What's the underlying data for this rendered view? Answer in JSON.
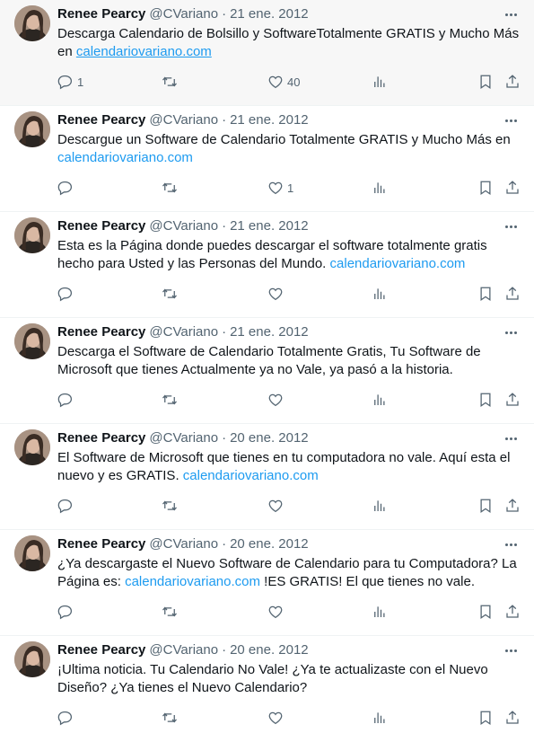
{
  "tweets": [
    {
      "name": "Renee Pearcy",
      "handle": "@CVariano",
      "dot": "·",
      "date": "21 ene. 2012",
      "text_before": "Descarga Calendario de Bolsillo y SoftwareTotalmente GRATIS y Mucho Más en ",
      "link": "calendariovariano.com",
      "text_after": "",
      "replies": "1",
      "retweets": "",
      "likes": "40",
      "highlighted": true
    },
    {
      "name": "Renee Pearcy",
      "handle": "@CVariano",
      "dot": "·",
      "date": "21 ene. 2012",
      "text_before": "Descargue un Software de Calendario Totalmente GRATIS y Mucho Más en ",
      "link": "calendariovariano.com",
      "text_after": "",
      "replies": "",
      "retweets": "",
      "likes": "1"
    },
    {
      "name": "Renee Pearcy",
      "handle": "@CVariano",
      "dot": "·",
      "date": "21 ene. 2012",
      "text_before": "Esta es la Página donde puedes descargar el software totalmente gratis hecho para Usted y las Personas del Mundo. ",
      "link": "calendariovariano.com",
      "text_after": "",
      "replies": "",
      "retweets": "",
      "likes": ""
    },
    {
      "name": "Renee Pearcy",
      "handle": "@CVariano",
      "dot": "·",
      "date": "21 ene. 2012",
      "text_before": "Descarga el Software de Calendario Totalmente Gratis, Tu Software de Microsoft que tienes Actualmente ya no Vale, ya pasó a la historia.",
      "link": "",
      "text_after": "",
      "replies": "",
      "retweets": "",
      "likes": ""
    },
    {
      "name": "Renee Pearcy",
      "handle": "@CVariano",
      "dot": "·",
      "date": "20 ene. 2012",
      "text_before": "El Software de Microsoft que tienes en tu computadora no vale. Aquí esta el nuevo y es GRATIS. ",
      "link": "calendariovariano.com",
      "text_after": "",
      "replies": "",
      "retweets": "",
      "likes": ""
    },
    {
      "name": "Renee Pearcy",
      "handle": "@CVariano",
      "dot": "·",
      "date": "20 ene. 2012",
      "text_before": "¿Ya descargaste el Nuevo Software de Calendario para tu Computadora? La Página es: ",
      "link": "calendariovariano.com",
      "text_after": " !ES GRATIS! El que tienes no vale.",
      "replies": "",
      "retweets": "",
      "likes": ""
    },
    {
      "name": "Renee Pearcy",
      "handle": "@CVariano",
      "dot": "·",
      "date": "20 ene. 2012",
      "text_before": "¡Ultima noticia. Tu Calendario No Vale! ¿Ya te actualizaste con el Nuevo Diseño? ¿Ya tienes el Nuevo Calendario?",
      "link": "",
      "text_after": "",
      "replies": "",
      "retweets": "",
      "likes": ""
    }
  ],
  "icons": {
    "more": "more-icon",
    "reply": "reply-icon",
    "retweet": "retweet-icon",
    "like": "heart-icon",
    "views": "views-icon",
    "bookmark": "bookmark-icon",
    "share": "share-icon"
  },
  "colors": {
    "link": "#1d9bf0",
    "muted": "#536471",
    "text": "#0f1419",
    "highlight_bg": "#f7f7f7"
  }
}
